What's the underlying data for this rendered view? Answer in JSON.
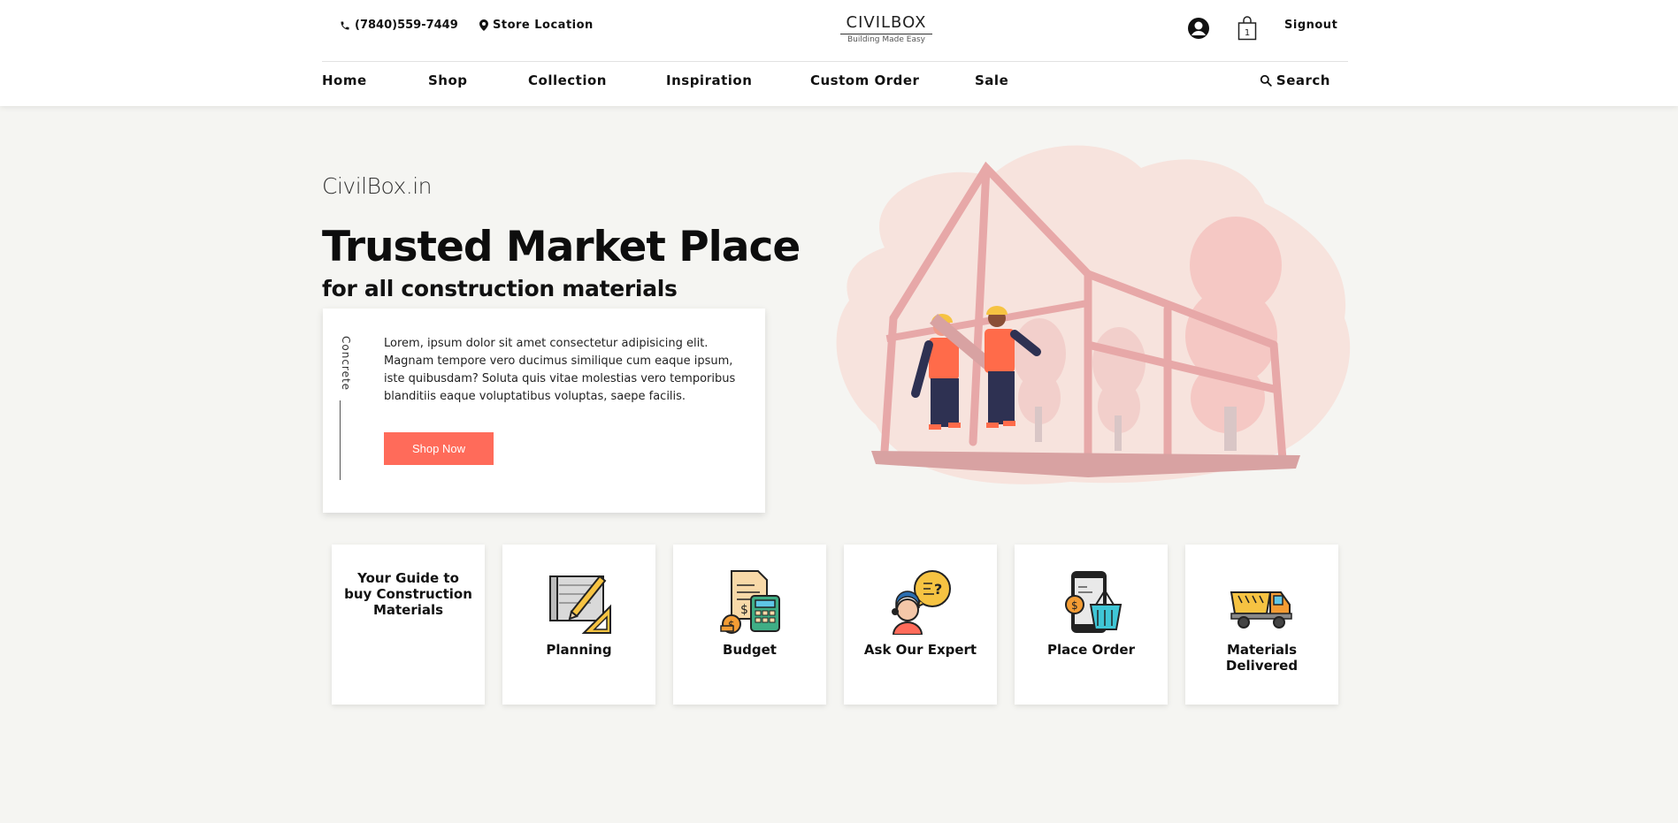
{
  "header": {
    "phone": "(7840)559-7449",
    "store_location": "Store Location",
    "logo_title": "CIVILBOX",
    "logo_tagline": "Building Made Easy",
    "cart_count": "1",
    "signout": "Signout"
  },
  "nav": {
    "items": [
      {
        "label": "Home"
      },
      {
        "label": "Shop"
      },
      {
        "label": "Collection"
      },
      {
        "label": "Inspiration"
      },
      {
        "label": "Custom Order"
      },
      {
        "label": "Sale"
      }
    ],
    "search": "Search"
  },
  "hero": {
    "brand": "CivilBox.in",
    "title": "Trusted Market Place",
    "subtitle": "for all construction materials",
    "card_label": "Concrete",
    "card_text": "Lorem, ipsum dolor sit amet consectetur adipisicing elit. Magnam tempore vero ducimus similique cum eaque ipsum, iste quibusdam? Soluta quis vitae molestias vero temporibus blanditiis eaque voluptatibus voluptas, saepe facilis.",
    "cta": "Shop Now"
  },
  "steps": {
    "guide": "Your Guide to buy Construction Materials",
    "items": [
      {
        "label": "Planning",
        "icon": "blueprint-icon"
      },
      {
        "label": "Budget",
        "icon": "calculator-icon"
      },
      {
        "label": "Ask Our Expert",
        "icon": "expert-icon"
      },
      {
        "label": "Place Order",
        "icon": "mobile-cart-icon"
      },
      {
        "label": "Materials Delivered",
        "icon": "dump-truck-icon"
      }
    ]
  },
  "colors": {
    "accent": "#ff6b5a",
    "background": "#f5f5f2",
    "illustration_pink": "#f7e3dd"
  }
}
